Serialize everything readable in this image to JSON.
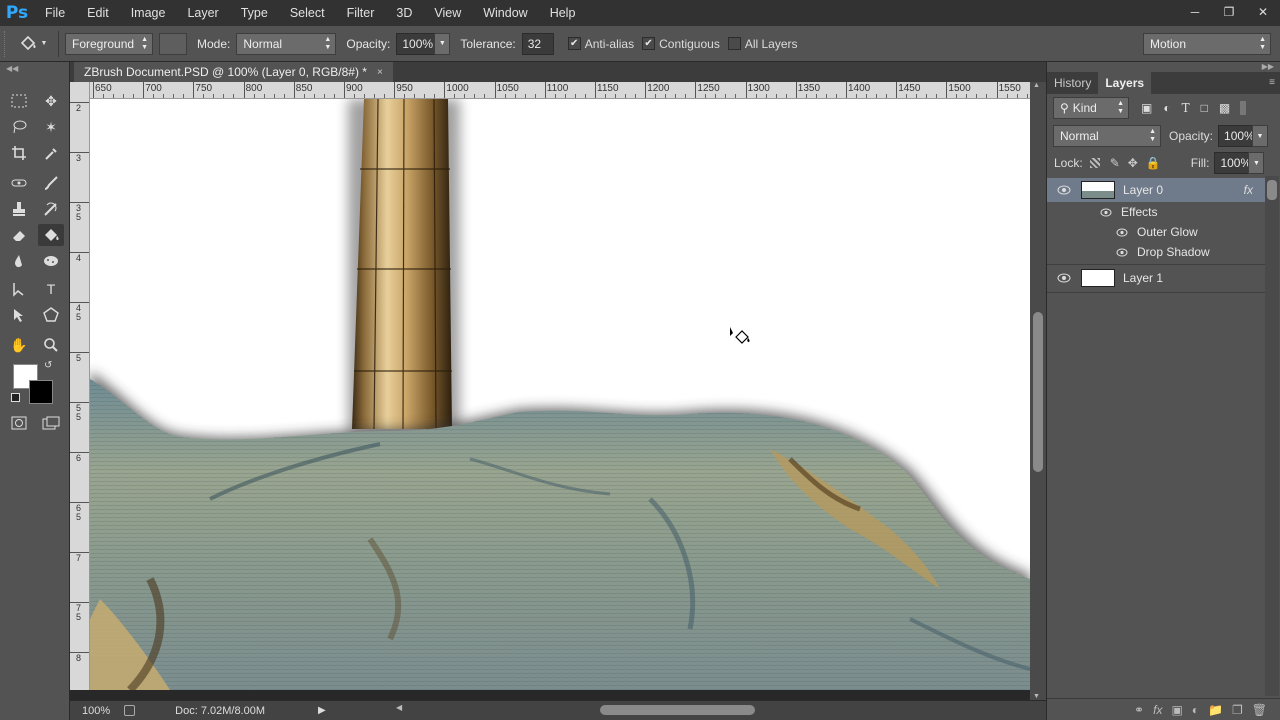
{
  "app": {
    "logo": "Ps"
  },
  "menu": [
    "File",
    "Edit",
    "Image",
    "Layer",
    "Type",
    "Select",
    "Filter",
    "3D",
    "View",
    "Window",
    "Help"
  ],
  "options": {
    "fill_source": "Foreground",
    "mode_label": "Mode:",
    "mode_value": "Normal",
    "opacity_label": "Opacity:",
    "opacity_value": "100%",
    "tolerance_label": "Tolerance:",
    "tolerance_value": "32",
    "anti_alias_label": "Anti-alias",
    "anti_alias_checked": true,
    "contiguous_label": "Contiguous",
    "contiguous_checked": true,
    "all_layers_label": "All Layers",
    "all_layers_checked": false,
    "workspace": "Motion"
  },
  "document": {
    "tab_title": "ZBrush Document.PSD @ 100% (Layer 0, RGB/8#) *",
    "close_glyph": "×"
  },
  "rulers": {
    "horizontal_ticks": [
      "650",
      "700",
      "750",
      "800",
      "850",
      "900",
      "950",
      "1000",
      "1050",
      "1100",
      "1150",
      "1200",
      "1250",
      "1300",
      "1350",
      "1400",
      "1450",
      "1500",
      "1550"
    ],
    "vertical_ticks": [
      "2",
      "3",
      "3 5",
      "4",
      "4 5",
      "5",
      "5 5",
      "6",
      "6 5",
      "7",
      "7 5",
      "8"
    ]
  },
  "status": {
    "zoom": "100%",
    "doc_size": "Doc: 7.02M/8.00M"
  },
  "panels": {
    "tabs": [
      "History",
      "Layers"
    ],
    "active_tab": "Layers",
    "filter_kind": "Kind",
    "blend_mode": "Normal",
    "opacity_label": "Opacity:",
    "opacity_value": "100%",
    "lock_label": "Lock:",
    "fill_label": "Fill:",
    "fill_value": "100%",
    "layers": [
      {
        "name": "Layer 0",
        "fx": "fx",
        "selected": true
      },
      {
        "name": "Layer 1",
        "selected": false
      }
    ],
    "effects_label": "Effects",
    "effects": [
      "Outer Glow",
      "Drop Shadow"
    ]
  },
  "colors": {
    "foreground": "#ffffff",
    "background": "#000000",
    "selected_layer": "#6f7a8a"
  }
}
